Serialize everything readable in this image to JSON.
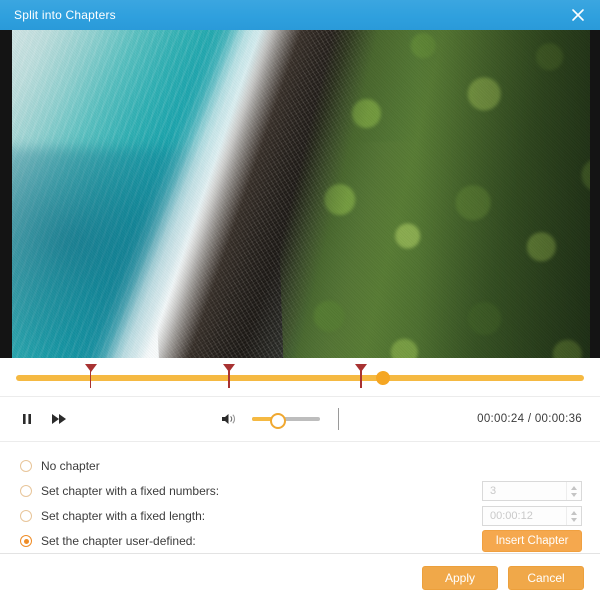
{
  "window": {
    "title": "Split into Chapters",
    "close_icon": "close-icon",
    "accent_blue": "#2fa0de",
    "accent_orange": "#f0a849"
  },
  "player": {
    "timeline": {
      "markers_percent": [
        13.2,
        37.5,
        60.8
      ],
      "playhead_percent": 64.6,
      "track_color": "#f5b942",
      "marker_color": "#a83232",
      "playhead_color": "#f5a623"
    },
    "controls": {
      "pause_icon": "pause-icon",
      "fast_forward_icon": "fast-forward-icon",
      "volume_icon": "volume-icon",
      "volume_percent": 35,
      "current_time": "00:00:24",
      "separator": "/",
      "total_time": "00:00:36"
    }
  },
  "options": {
    "items": [
      {
        "label": "No chapter",
        "checked": false,
        "control": "none"
      },
      {
        "label": "Set chapter with a fixed numbers:",
        "checked": false,
        "control": "spinner",
        "value": "3",
        "disabled": true
      },
      {
        "label": "Set chapter with a fixed length:",
        "checked": false,
        "control": "spinner",
        "value": "00:00:12",
        "disabled": true
      },
      {
        "label": "Set the chapter user-defined:",
        "checked": true,
        "control": "button",
        "button_label": "Insert Chapter"
      }
    ]
  },
  "footer": {
    "apply_label": "Apply",
    "cancel_label": "Cancel"
  }
}
